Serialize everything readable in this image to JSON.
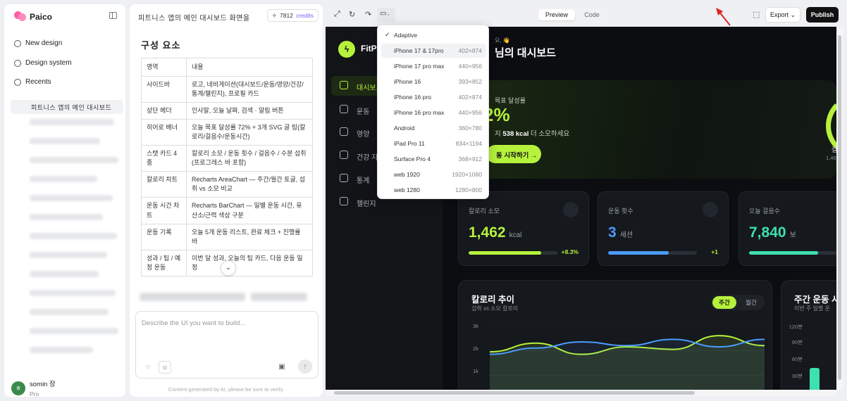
{
  "sidebar": {
    "brand": "Paico",
    "nav": [
      {
        "label": "New design",
        "icon": "edit-icon"
      },
      {
        "label": "Design system",
        "icon": "palette-icon"
      },
      {
        "label": "Recents",
        "icon": "history-icon"
      }
    ],
    "recent_active": "피트니스 앱의 메인 대시보드",
    "user": {
      "name": "somin 장",
      "plan": "Pro",
      "initial": "ㅎ"
    }
  },
  "chat": {
    "title": "피트니스 앱의 메인 대시보드 화면을",
    "credits_value": "7812",
    "credits_label": "credits",
    "section_heading": "구성 요소",
    "table": {
      "headers": [
        "영역",
        "내용"
      ],
      "rows": [
        [
          "사이드바",
          "로고, 네비게이션(대시보드/운동/영양/건강/통계/챌린지), 프로필 카드"
        ],
        [
          "상단 헤더",
          "인사말, 오늘 날짜, 검색 · 알림 버튼"
        ],
        [
          "히어로 배너",
          "오늘 목표 달성률 72% + 3개 SVG 골 링(칼로리/걸음수/운동시간)"
        ],
        [
          "스탯 카드 4종",
          "칼로리 소모 / 운동 횟수 / 걸음수 / 수분 섭취 (프로그레스 바 포함)"
        ],
        [
          "칼로리 차트",
          "Recharts AreaChart — 주간/월간 토글, 섭취 vs 소모 비교"
        ],
        [
          "운동 시간 차트",
          "Recharts BarChart — 일별 운동 시간, 유산소/근력 색상 구분"
        ],
        [
          "운동 기록",
          "오늘 5개 운동 리스트, 완료 체크 + 진행률 바"
        ],
        [
          "성과 / 팁 / 예정 운동",
          "이번 달 성과, 오늘의 팁 카드, 다음 운동 일정"
        ]
      ]
    },
    "composer_placeholder": "Describe the UI you want to build...",
    "disclaimer": "Content generated by AI, please be sure to verify."
  },
  "toolbar": {
    "tabs": [
      "Preview",
      "Code"
    ],
    "active_tab": "Preview",
    "export_label": "Export",
    "publish_label": "Publish"
  },
  "device_menu": {
    "items": [
      {
        "name": "Adaptive",
        "dims": "",
        "checked": true
      },
      {
        "name": "iPhone 17 & 17pro",
        "dims": "402×874",
        "highlighted": true
      },
      {
        "name": "iPhone 17 pro max",
        "dims": "440×956"
      },
      {
        "name": "iPhone 16",
        "dims": "393×852"
      },
      {
        "name": "iPhone 16 pro",
        "dims": "402×874"
      },
      {
        "name": "iPhone 16 pro max",
        "dims": "440×956"
      },
      {
        "name": "Android",
        "dims": "360×780"
      },
      {
        "name": "iPad Pro 11",
        "dims": "834×1194"
      },
      {
        "name": "Surface Pro 4",
        "dims": "368×912"
      },
      {
        "name": "web 1920",
        "dims": "1920×1080"
      },
      {
        "name": "web 1280",
        "dims": "1280×800"
      }
    ]
  },
  "preview_app": {
    "brand": "FitP",
    "greeting_small": "요, 👋",
    "greeting": "님의 대시보드",
    "nav": [
      "대시보드",
      "운동",
      "영양",
      "건강 지",
      "통계",
      "챌린지"
    ],
    "hero": {
      "label": "목표 달성률",
      "percent": "2%",
      "sub_prefix": "지",
      "sub_kcal": "538 kcal",
      "sub_suffix": "더 소모하세요",
      "cta": "동 시작하기 →",
      "ring_label": "칼",
      "ring_value": "1,46"
    },
    "stats": [
      {
        "title": "칼로리 소모",
        "value": "1,462",
        "unit": "kcal",
        "delta": "+8.3%",
        "progress": 0.82,
        "color": "#b6f23c",
        "delta_color": "#b6f23c"
      },
      {
        "title": "운동 횟수",
        "value": "3",
        "unit": "세션",
        "delta": "+1",
        "progress": 0.68,
        "color": "#4b9bff",
        "delta_color": "#b6f23c"
      },
      {
        "title": "오늘 걸음수",
        "value": "7,840",
        "unit": "보",
        "delta": "",
        "progress": 0.78,
        "color": "#3de0b0",
        "delta_color": "#3de0b0"
      }
    ],
    "calorie_chart": {
      "title": "칼로리 추이",
      "subtitle": "섭취 vs 소모 칼로리",
      "toggle": [
        "주간",
        "월간"
      ],
      "y_ticks": [
        "3k",
        "2k",
        "1k",
        "0"
      ]
    },
    "weekly_chart": {
      "title": "주간 운동 시",
      "subtitle": "이번 주 일별 운",
      "y_ticks": [
        "120분",
        "90분",
        "60분",
        "30분"
      ]
    }
  },
  "chart_data": {
    "type": "area",
    "title": "칼로리 추이",
    "subtitle": "섭취 vs 소모 칼로리",
    "ylim": [
      0,
      3000
    ],
    "series": [
      {
        "color": "#b6f23c",
        "values": [
          1950,
          2300,
          1850,
          2150,
          2050,
          2600,
          2200
        ]
      },
      {
        "color": "#4b9bff",
        "values": [
          1850,
          2100,
          2350,
          2200,
          2450,
          2150,
          2450
        ]
      }
    ]
  }
}
